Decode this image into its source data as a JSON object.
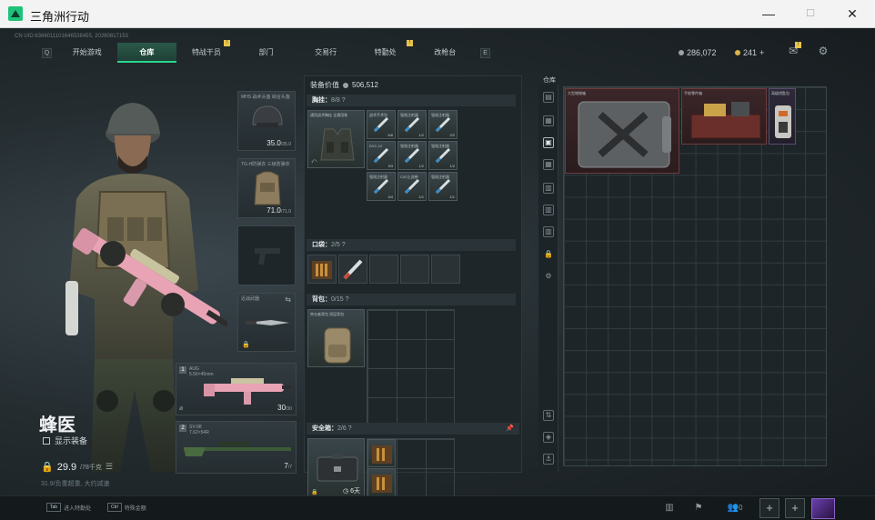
{
  "window": {
    "title": "三角洲行动",
    "minimize": "—",
    "maximize": "☐",
    "close": "✕"
  },
  "uid": "CN UID:6366011101646538455, 20260817153",
  "nav": {
    "key_left": "Q",
    "key_right": "E",
    "tabs": [
      "开始游戏",
      "仓库",
      "特战干员",
      "部门",
      "交易行",
      "特勤处",
      "改枪台"
    ],
    "active_index": 1
  },
  "currency": {
    "silver": "286,072",
    "gold": "241",
    "plus": "+"
  },
  "operator": {
    "name": "蜂医",
    "show_equipment": "显示装备",
    "weight": "29.9",
    "weight_max": "/78千克",
    "weight_note": "31.9/负重超重, 大约减速",
    "helmet": {
      "name": "MHS 战术头盔 综合头盔",
      "dur": "35.0",
      "max": "/35.0"
    },
    "armor": {
      "name": "TG-H防弹衣 三级防弹衣",
      "dur": "71.0",
      "max": "/71.0"
    },
    "melee": {
      "name": "近战武器"
    },
    "primary1": {
      "name": "AUG",
      "sub": "5.56×45mm",
      "ammo": "30",
      "ammo_max": "/30",
      "lvl": "1"
    },
    "primary2": {
      "name": "SV-98",
      "sub": "7.62×54R",
      "ammo": "7",
      "ammo_max": "/7",
      "lvl": "2"
    }
  },
  "loadout": {
    "value_label": "装备价值",
    "value": "506,512",
    "chest": {
      "label": "胸挂",
      "count": "8",
      "max": "/8"
    },
    "chest_rig_name": "通用战术胸挂 全通用装",
    "chest_items": [
      "战术手术包",
      "强效注射器",
      "强效注射器",
      "DVC-12",
      "强效注射器",
      "强效注射器",
      "强效注射器",
      "CAT止血带",
      "强效注射器"
    ],
    "chest_counts": [
      "6/8",
      "1/2",
      "2/2",
      "3/3",
      "1/2",
      "1/2",
      "4/4",
      "1/1",
      "1/1"
    ],
    "pockets": {
      "label": "口袋",
      "count": "2",
      "max": "/5"
    },
    "pocket_items": [
      "弹药",
      "强效注射器"
    ],
    "backpack": {
      "label": "背包",
      "count": "0",
      "max": "/15"
    },
    "backpack_name": "突击者背包 双层背包",
    "safe": {
      "label": "安全箱",
      "count": "2",
      "max": "/6",
      "timer": "6天"
    }
  },
  "stash": {
    "label": "仓库",
    "items": [
      "大型储物箱",
      "手枪零件箱",
      "高级钥匙包"
    ]
  },
  "bottom": {
    "hint1_key": "Tab",
    "hint1": "进入特勤处",
    "hint2_key": "Ctrl",
    "hint2": "特殊金额",
    "friends": "0"
  },
  "colors": {
    "accent": "#29d48c",
    "weight": "#e7c34a",
    "aug": "#e8a3b5"
  }
}
